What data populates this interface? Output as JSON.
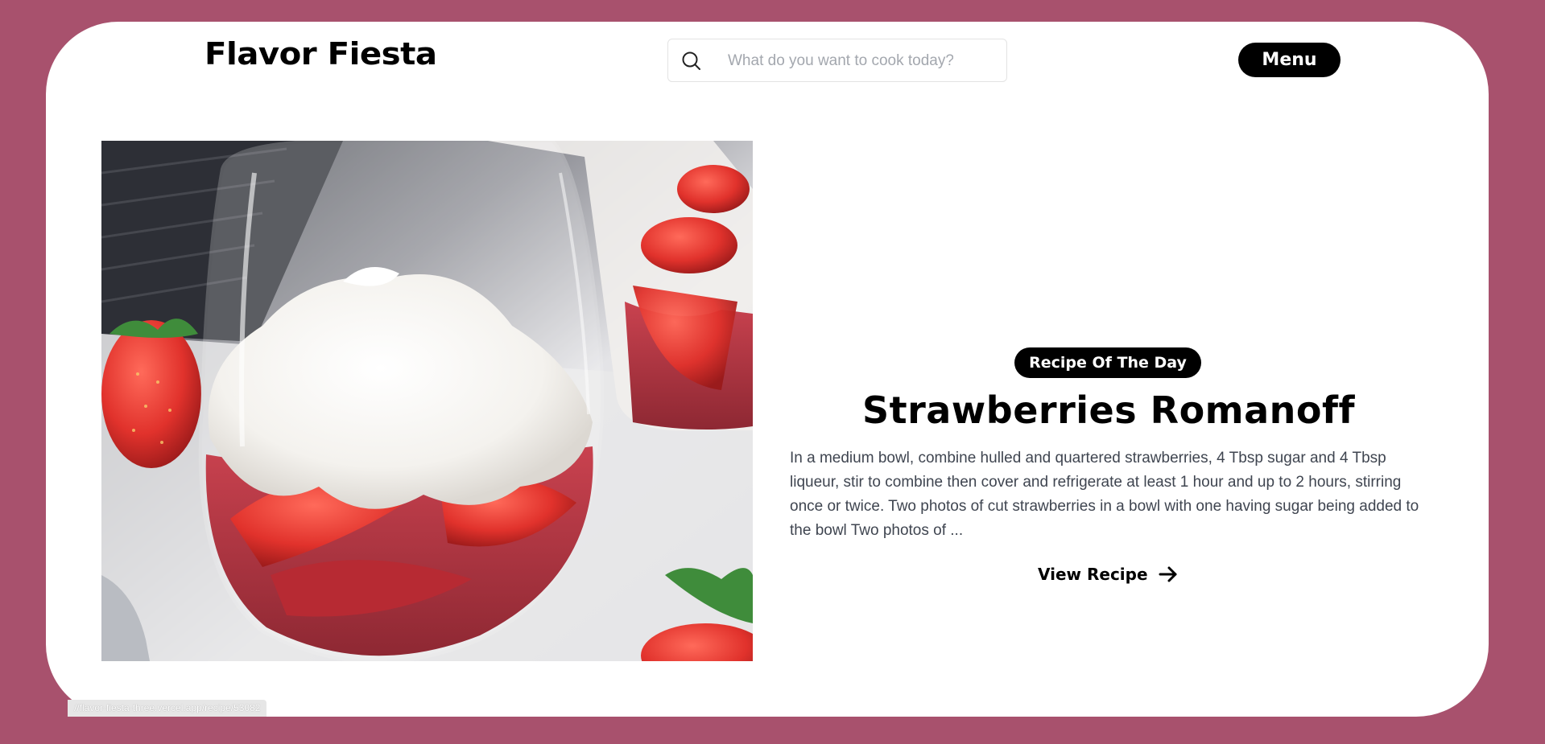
{
  "header": {
    "logo": "Flavor Fiesta",
    "search_placeholder": "What do you want to cook today?",
    "menu_label": "Menu"
  },
  "hero": {
    "badge": "Recipe Of The Day",
    "title": "Strawberries Romanoff",
    "description": "In a medium bowl, combine hulled and quartered strawberries, 4 Tbsp sugar and 4 Tbsp liqueur, stir to combine then cover and refrigerate at least 1 hour and up to 2 hours, stirring once or twice. Two photos of cut strawberries in a bowl with one having sugar being added to the bowl Two photos of ...",
    "link_label": "View Recipe",
    "image_alt": "Strawberries Romanoff"
  },
  "status_bar": {
    "url": "//flavor-fiesta-three.vercel.app/recipe/53082"
  },
  "colors": {
    "background": "#a8516d",
    "card": "#ffffff",
    "accent": "#000000",
    "body_text": "#3f4550"
  },
  "icons": {
    "search": "search-icon",
    "arrow": "arrow-right-icon"
  }
}
